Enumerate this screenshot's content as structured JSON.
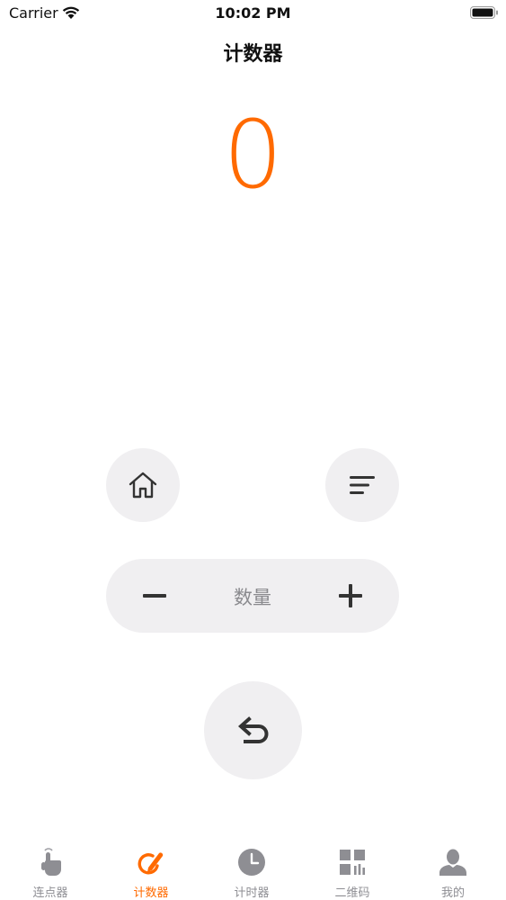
{
  "status_bar": {
    "carrier": "Carrier",
    "time": "10:02 PM"
  },
  "nav": {
    "title": "计数器"
  },
  "counter": {
    "value": "0",
    "color": "#ff6a00"
  },
  "controls": {
    "home_icon": "home-icon",
    "menu_icon": "menu-lines-icon",
    "minus_icon": "minus-icon",
    "quantity_label": "数量",
    "plus_icon": "plus-icon",
    "undo_icon": "undo-icon"
  },
  "tab_bar": {
    "active_color": "#ff6a00",
    "inactive_color": "#8e8e93",
    "tabs": [
      {
        "label": "连点器",
        "icon": "tap-hand-icon",
        "active": false
      },
      {
        "label": "计数器",
        "icon": "counter-pen-icon",
        "active": true
      },
      {
        "label": "计时器",
        "icon": "clock-icon",
        "active": false
      },
      {
        "label": "二维码",
        "icon": "qr-code-icon",
        "active": false
      },
      {
        "label": "我的",
        "icon": "person-icon",
        "active": false
      }
    ]
  }
}
